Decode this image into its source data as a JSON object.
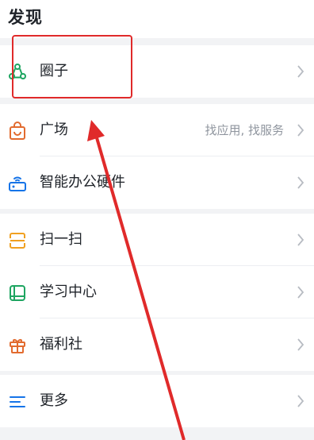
{
  "header": {
    "title": "发现"
  },
  "group1": [
    {
      "label": "圈子",
      "icon": "circle-network-icon"
    }
  ],
  "group2": [
    {
      "label": "广场",
      "hint": "找应用, 找服务",
      "icon": "shopping-bag-icon"
    },
    {
      "label": "智能办公硬件",
      "icon": "router-device-icon"
    }
  ],
  "group3": [
    {
      "label": "扫一扫",
      "icon": "scan-icon"
    },
    {
      "label": "学习中心",
      "icon": "book-icon"
    },
    {
      "label": "福利社",
      "icon": "gift-icon"
    }
  ],
  "group4": [
    {
      "label": "更多",
      "icon": "more-menu-icon"
    }
  ],
  "colors": {
    "green": "#1ea561",
    "orange": "#e26b2f",
    "blue": "#1674e8",
    "amber": "#f0a020",
    "annotation_red": "#e02a2a"
  }
}
